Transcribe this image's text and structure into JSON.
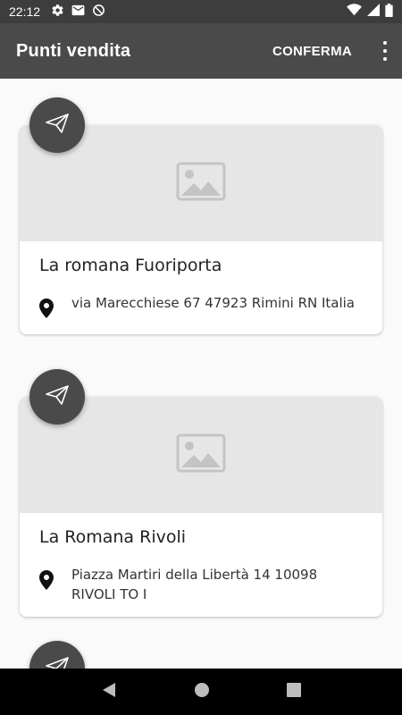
{
  "status_bar": {
    "time": "22:12",
    "left_icons": [
      "gear-icon",
      "mail-icon",
      "sync-icon"
    ],
    "right_icons": [
      "wifi-icon",
      "signal-icon",
      "battery-icon"
    ]
  },
  "app_bar": {
    "title": "Punti vendita",
    "confirm_label": "CONFERMA",
    "menu_icon": "more-vert-icon"
  },
  "stores": [
    {
      "name": "La romana Fuoriporta",
      "address": "via Marecchiese 67 47923 Rimini RN Italia"
    },
    {
      "name": "La Romana Rivoli",
      "address": "Piazza Martiri della Libertà 14 10098 RIVOLI TO I"
    }
  ],
  "nav_bar": {
    "icons": [
      "back-icon",
      "home-icon",
      "recents-icon"
    ]
  },
  "colors": {
    "app_bar": "#4a4a4a",
    "status_bar": "#3d3d3d",
    "background": "#fafafa",
    "image_placeholder": "#e6e6e6"
  }
}
